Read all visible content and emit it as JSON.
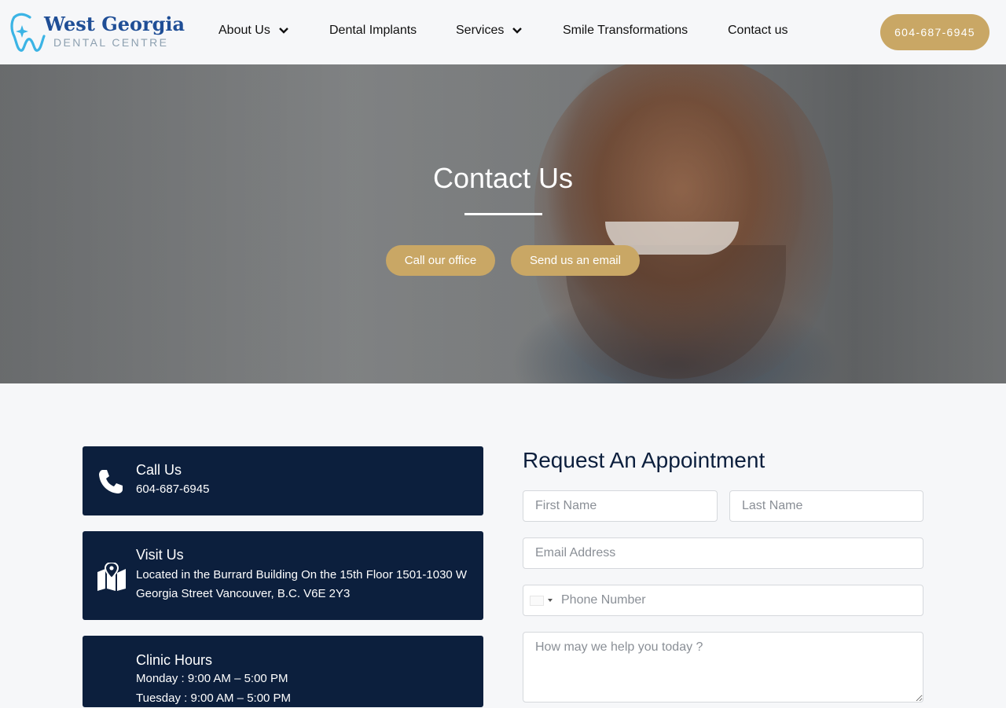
{
  "header": {
    "logo": {
      "title": "West Georgia",
      "subtitle": "DENTAL CENTRE",
      "icon": "tooth-sparkle-icon"
    },
    "nav": [
      {
        "label": "About Us",
        "has_dropdown": true
      },
      {
        "label": "Dental Implants",
        "has_dropdown": false
      },
      {
        "label": "Services",
        "has_dropdown": true
      },
      {
        "label": "Smile Transformations",
        "has_dropdown": false
      },
      {
        "label": "Contact us",
        "has_dropdown": false
      }
    ],
    "phone_button": "604-687-6945"
  },
  "hero": {
    "title": "Contact Us",
    "buttons": {
      "call": "Call our office",
      "email": "Send us an email"
    }
  },
  "cards": {
    "call": {
      "title": "Call Us",
      "text": "604-687-6945",
      "icon": "phone-icon"
    },
    "visit": {
      "title": "Visit Us",
      "text_line1": "Located in the Burrard Building On the 15th Floor 1501-1030 W",
      "text_line2": "Georgia Street Vancouver, B.C. V6E 2Y3",
      "icon": "map-pin-icon"
    },
    "hours": {
      "title": "Clinic Hours",
      "lines": [
        "Monday : 9:00 AM – 5:00 PM",
        "Tuesday : 9:00 AM – 5:00 PM"
      ]
    }
  },
  "form": {
    "title": "Request An Appointment",
    "first_name": {
      "placeholder": "First Name",
      "value": ""
    },
    "last_name": {
      "placeholder": "Last Name",
      "value": ""
    },
    "email": {
      "placeholder": "Email Address",
      "value": ""
    },
    "phone": {
      "placeholder": "Phone Number",
      "value": ""
    },
    "message": {
      "placeholder": "How may we help you today ?",
      "value": ""
    }
  },
  "colors": {
    "accent_gold": "#c9a765",
    "navy": "#0c1f3d",
    "logo_blue": "#1f4e96",
    "background": "#f6f7f9"
  }
}
